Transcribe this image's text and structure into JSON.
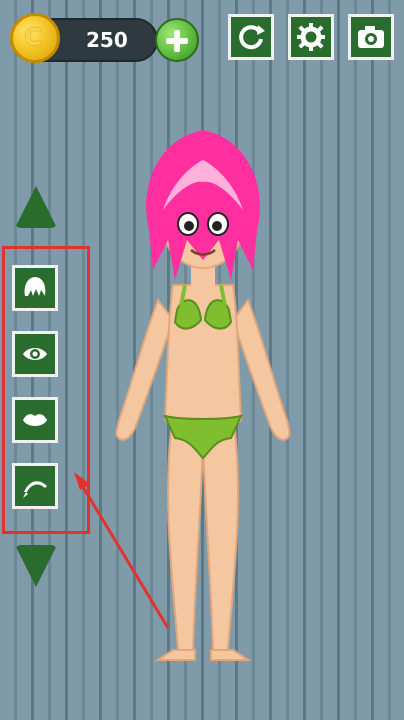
{
  "header": {
    "coins": "250",
    "coin_symbol": "C"
  },
  "icons": {
    "add_coins": "plus-icon",
    "refresh": "refresh-icon",
    "settings": "gear-icon",
    "camera": "camera-icon",
    "hair": "hair-icon",
    "eye": "eye-icon",
    "lips": "lips-icon",
    "eyebrow": "eyebrow-icon",
    "scroll_up": "triangle-up-icon",
    "scroll_down": "triangle-down-icon"
  },
  "colors": {
    "button_green": "#2a6b2e",
    "highlight_red": "#e2322f",
    "hair_pink": "#ff2fa0",
    "outfit_green": "#7fbf2f",
    "skin": "#f4c7a0"
  }
}
